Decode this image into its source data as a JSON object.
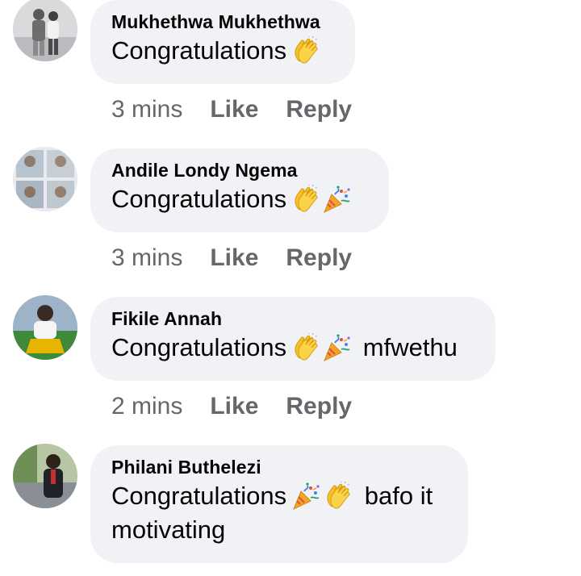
{
  "comments": [
    {
      "author": "Mukhethwa Mukhethwa",
      "text": "Congratulations",
      "emojis": [
        "clapping-hands-emoji"
      ],
      "suffix": "",
      "time": "3 mins",
      "like_label": "Like",
      "reply_label": "Reply"
    },
    {
      "author": "Andile Londy Ngema",
      "text": "Congratulations",
      "emojis": [
        "clapping-hands-emoji",
        "party-popper-emoji"
      ],
      "suffix": "",
      "time": "3 mins",
      "like_label": "Like",
      "reply_label": "Reply"
    },
    {
      "author": "Fikile Annah",
      "text": "Congratulations",
      "emojis": [
        "clapping-hands-emoji",
        "party-popper-emoji"
      ],
      "suffix": "mfwethu",
      "time": "2 mins",
      "like_label": "Like",
      "reply_label": "Reply"
    },
    {
      "author": "Philani Buthelezi",
      "text": "Congratulations",
      "emojis": [
        "party-popper-emoji",
        "clapping-hands-emoji"
      ],
      "suffix": "bafo it motivating",
      "time": "",
      "like_label": "",
      "reply_label": ""
    }
  ],
  "colors": {
    "bubble_bg": "#f0f2f5",
    "author_text": "#050505",
    "meta_text": "#65676b"
  }
}
